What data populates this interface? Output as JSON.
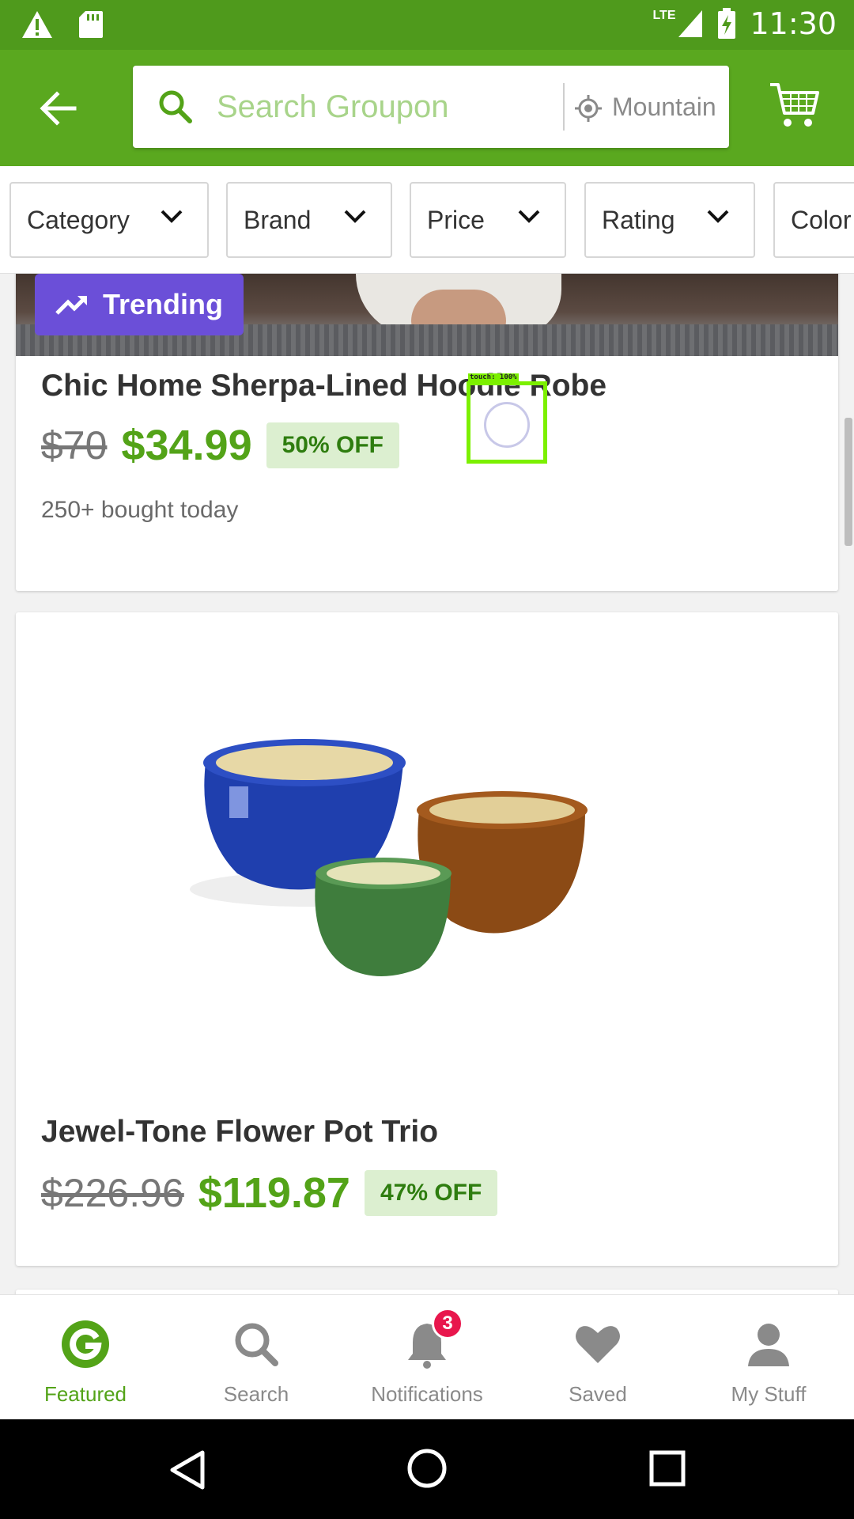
{
  "status_bar": {
    "time": "11:30",
    "network": "LTE"
  },
  "app_bar": {
    "search_placeholder": "Search Groupon",
    "location": "Mountain View"
  },
  "filters": [
    {
      "label": "Category"
    },
    {
      "label": "Brand"
    },
    {
      "label": "Price"
    },
    {
      "label": "Rating"
    },
    {
      "label": "Color"
    }
  ],
  "products": [
    {
      "badge": "Trending",
      "title": "Chic Home Sherpa-Lined Hoodie Robe",
      "old_price": "$70",
      "new_price": "$34.99",
      "discount": "50% OFF",
      "bought": "250+ bought today"
    },
    {
      "title": "Jewel-Tone Flower Pot Trio",
      "old_price": "$226.96",
      "new_price": "$119.87",
      "discount": "47% OFF"
    }
  ],
  "touch_overlay": {
    "label": "touch: 100%"
  },
  "bottom_nav": {
    "items": [
      {
        "label": "Featured"
      },
      {
        "label": "Search"
      },
      {
        "label": "Notifications",
        "badge": "3"
      },
      {
        "label": "Saved"
      },
      {
        "label": "My Stuff"
      }
    ]
  },
  "colors": {
    "brand_green": "#53a318",
    "trending_purple": "#6b4fd8",
    "badge_red": "#e8174d"
  }
}
